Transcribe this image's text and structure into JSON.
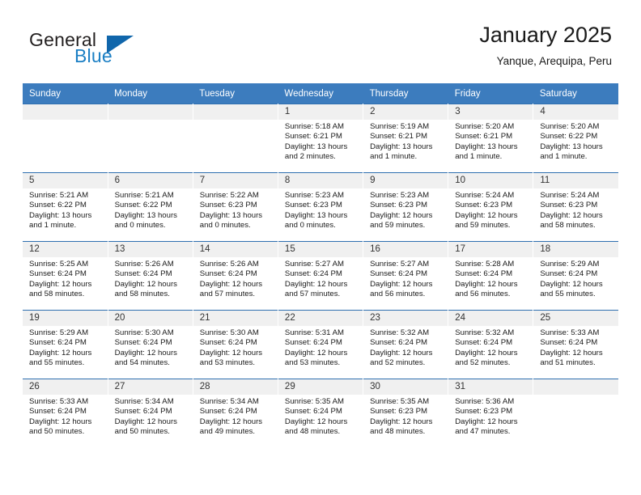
{
  "brand": {
    "name_part1": "General",
    "name_part2": "Blue",
    "triangle_icon": "brand-triangle-icon"
  },
  "header": {
    "title": "January 2025",
    "subtitle": "Yanque, Arequipa, Peru"
  },
  "calendar": {
    "weekday_headers": [
      "Sunday",
      "Monday",
      "Tuesday",
      "Wednesday",
      "Thursday",
      "Friday",
      "Saturday"
    ],
    "accent_color": "#3c7cbe",
    "daynum_bg": "#f0f0f0",
    "weeks": [
      [
        {
          "day": "",
          "empty": true
        },
        {
          "day": "",
          "empty": true
        },
        {
          "day": "",
          "empty": true
        },
        {
          "day": "1",
          "sunrise": "Sunrise: 5:18 AM",
          "sunset": "Sunset: 6:21 PM",
          "daylight": "Daylight: 13 hours and 2 minutes."
        },
        {
          "day": "2",
          "sunrise": "Sunrise: 5:19 AM",
          "sunset": "Sunset: 6:21 PM",
          "daylight": "Daylight: 13 hours and 1 minute."
        },
        {
          "day": "3",
          "sunrise": "Sunrise: 5:20 AM",
          "sunset": "Sunset: 6:21 PM",
          "daylight": "Daylight: 13 hours and 1 minute."
        },
        {
          "day": "4",
          "sunrise": "Sunrise: 5:20 AM",
          "sunset": "Sunset: 6:22 PM",
          "daylight": "Daylight: 13 hours and 1 minute."
        }
      ],
      [
        {
          "day": "5",
          "sunrise": "Sunrise: 5:21 AM",
          "sunset": "Sunset: 6:22 PM",
          "daylight": "Daylight: 13 hours and 1 minute."
        },
        {
          "day": "6",
          "sunrise": "Sunrise: 5:21 AM",
          "sunset": "Sunset: 6:22 PM",
          "daylight": "Daylight: 13 hours and 0 minutes."
        },
        {
          "day": "7",
          "sunrise": "Sunrise: 5:22 AM",
          "sunset": "Sunset: 6:23 PM",
          "daylight": "Daylight: 13 hours and 0 minutes."
        },
        {
          "day": "8",
          "sunrise": "Sunrise: 5:23 AM",
          "sunset": "Sunset: 6:23 PM",
          "daylight": "Daylight: 13 hours and 0 minutes."
        },
        {
          "day": "9",
          "sunrise": "Sunrise: 5:23 AM",
          "sunset": "Sunset: 6:23 PM",
          "daylight": "Daylight: 12 hours and 59 minutes."
        },
        {
          "day": "10",
          "sunrise": "Sunrise: 5:24 AM",
          "sunset": "Sunset: 6:23 PM",
          "daylight": "Daylight: 12 hours and 59 minutes."
        },
        {
          "day": "11",
          "sunrise": "Sunrise: 5:24 AM",
          "sunset": "Sunset: 6:23 PM",
          "daylight": "Daylight: 12 hours and 58 minutes."
        }
      ],
      [
        {
          "day": "12",
          "sunrise": "Sunrise: 5:25 AM",
          "sunset": "Sunset: 6:24 PM",
          "daylight": "Daylight: 12 hours and 58 minutes."
        },
        {
          "day": "13",
          "sunrise": "Sunrise: 5:26 AM",
          "sunset": "Sunset: 6:24 PM",
          "daylight": "Daylight: 12 hours and 58 minutes."
        },
        {
          "day": "14",
          "sunrise": "Sunrise: 5:26 AM",
          "sunset": "Sunset: 6:24 PM",
          "daylight": "Daylight: 12 hours and 57 minutes."
        },
        {
          "day": "15",
          "sunrise": "Sunrise: 5:27 AM",
          "sunset": "Sunset: 6:24 PM",
          "daylight": "Daylight: 12 hours and 57 minutes."
        },
        {
          "day": "16",
          "sunrise": "Sunrise: 5:27 AM",
          "sunset": "Sunset: 6:24 PM",
          "daylight": "Daylight: 12 hours and 56 minutes."
        },
        {
          "day": "17",
          "sunrise": "Sunrise: 5:28 AM",
          "sunset": "Sunset: 6:24 PM",
          "daylight": "Daylight: 12 hours and 56 minutes."
        },
        {
          "day": "18",
          "sunrise": "Sunrise: 5:29 AM",
          "sunset": "Sunset: 6:24 PM",
          "daylight": "Daylight: 12 hours and 55 minutes."
        }
      ],
      [
        {
          "day": "19",
          "sunrise": "Sunrise: 5:29 AM",
          "sunset": "Sunset: 6:24 PM",
          "daylight": "Daylight: 12 hours and 55 minutes."
        },
        {
          "day": "20",
          "sunrise": "Sunrise: 5:30 AM",
          "sunset": "Sunset: 6:24 PM",
          "daylight": "Daylight: 12 hours and 54 minutes."
        },
        {
          "day": "21",
          "sunrise": "Sunrise: 5:30 AM",
          "sunset": "Sunset: 6:24 PM",
          "daylight": "Daylight: 12 hours and 53 minutes."
        },
        {
          "day": "22",
          "sunrise": "Sunrise: 5:31 AM",
          "sunset": "Sunset: 6:24 PM",
          "daylight": "Daylight: 12 hours and 53 minutes."
        },
        {
          "day": "23",
          "sunrise": "Sunrise: 5:32 AM",
          "sunset": "Sunset: 6:24 PM",
          "daylight": "Daylight: 12 hours and 52 minutes."
        },
        {
          "day": "24",
          "sunrise": "Sunrise: 5:32 AM",
          "sunset": "Sunset: 6:24 PM",
          "daylight": "Daylight: 12 hours and 52 minutes."
        },
        {
          "day": "25",
          "sunrise": "Sunrise: 5:33 AM",
          "sunset": "Sunset: 6:24 PM",
          "daylight": "Daylight: 12 hours and 51 minutes."
        }
      ],
      [
        {
          "day": "26",
          "sunrise": "Sunrise: 5:33 AM",
          "sunset": "Sunset: 6:24 PM",
          "daylight": "Daylight: 12 hours and 50 minutes."
        },
        {
          "day": "27",
          "sunrise": "Sunrise: 5:34 AM",
          "sunset": "Sunset: 6:24 PM",
          "daylight": "Daylight: 12 hours and 50 minutes."
        },
        {
          "day": "28",
          "sunrise": "Sunrise: 5:34 AM",
          "sunset": "Sunset: 6:24 PM",
          "daylight": "Daylight: 12 hours and 49 minutes."
        },
        {
          "day": "29",
          "sunrise": "Sunrise: 5:35 AM",
          "sunset": "Sunset: 6:24 PM",
          "daylight": "Daylight: 12 hours and 48 minutes."
        },
        {
          "day": "30",
          "sunrise": "Sunrise: 5:35 AM",
          "sunset": "Sunset: 6:23 PM",
          "daylight": "Daylight: 12 hours and 48 minutes."
        },
        {
          "day": "31",
          "sunrise": "Sunrise: 5:36 AM",
          "sunset": "Sunset: 6:23 PM",
          "daylight": "Daylight: 12 hours and 47 minutes."
        },
        {
          "day": "",
          "empty": true
        }
      ]
    ]
  }
}
